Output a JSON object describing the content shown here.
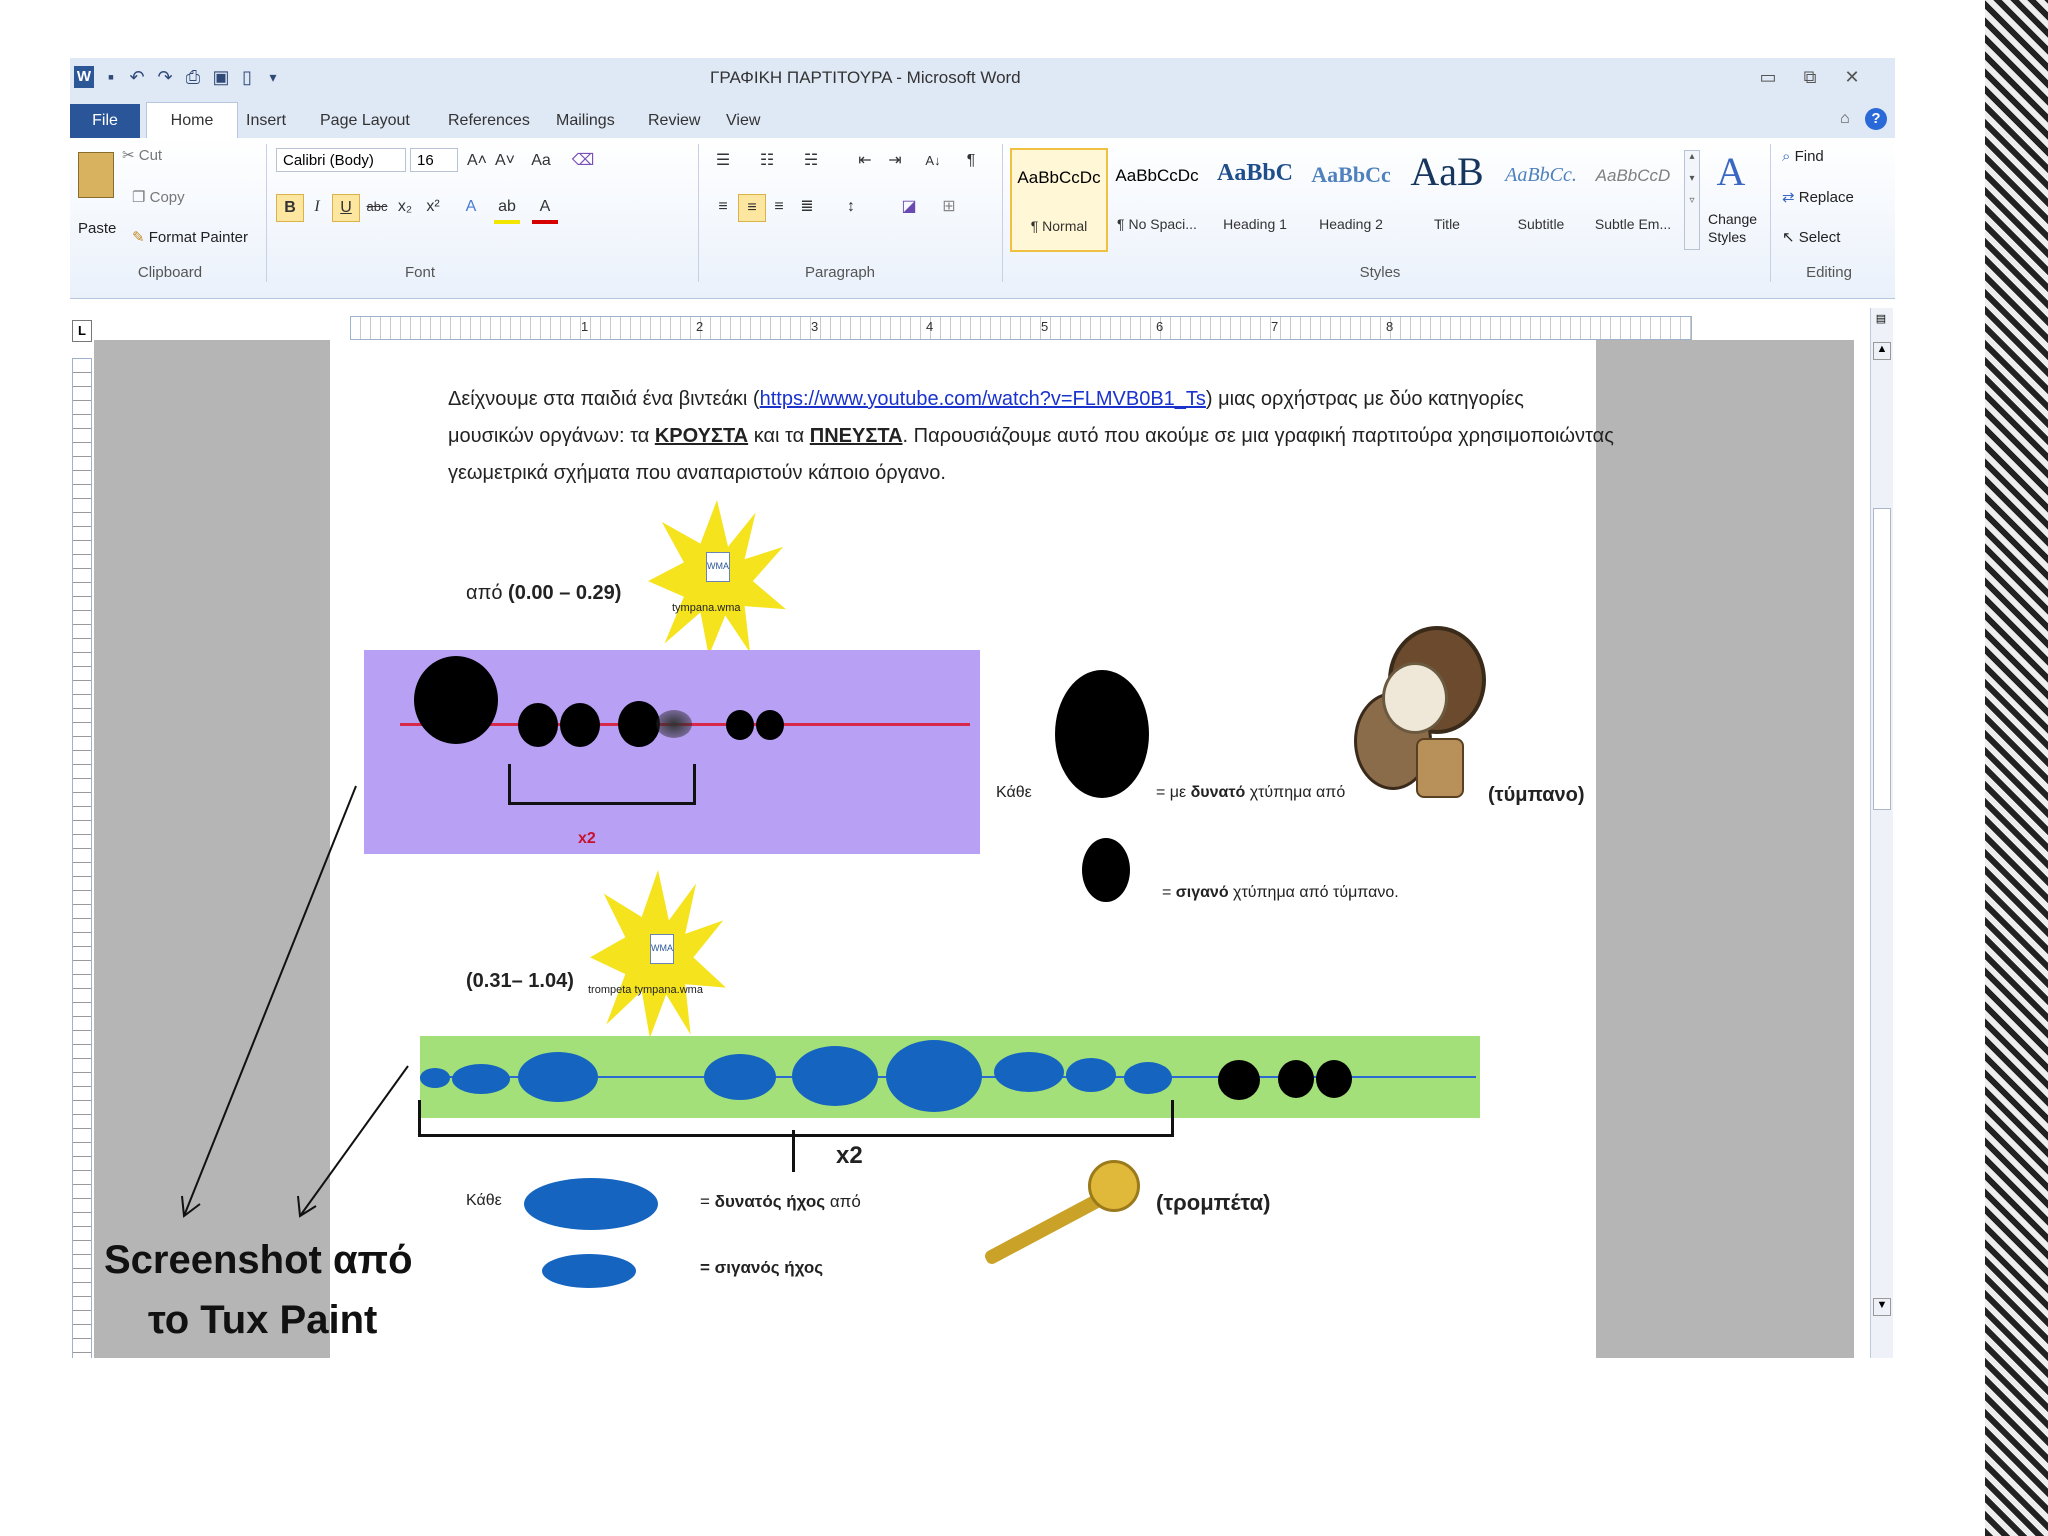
{
  "window": {
    "title": "ΓΡΑΦΙΚΗ ΠΑΡΤΙΤΟΥΡΑ - Microsoft Word",
    "controls": [
      "▭",
      "⧉",
      "✕"
    ]
  },
  "tabs": [
    "File",
    "Home",
    "Insert",
    "Page Layout",
    "References",
    "Mailings",
    "Review",
    "View"
  ],
  "ribbon": {
    "clipboard": {
      "paste": "Paste",
      "cut": "Cut",
      "copy": "Copy",
      "format_painter": "Format Painter",
      "label": "Clipboard"
    },
    "font": {
      "name": "Calibri (Body)",
      "size": "16",
      "label": "Font"
    },
    "paragraph": {
      "label": "Paragraph"
    },
    "styles": {
      "label": "Styles",
      "items": [
        {
          "sample": "AaBbCcDc",
          "name": "¶ Normal"
        },
        {
          "sample": "AaBbCcDc",
          "name": "¶ No Spaci..."
        },
        {
          "sample": "AaBbC",
          "name": "Heading 1"
        },
        {
          "sample": "AaBbCc",
          "name": "Heading 2"
        },
        {
          "sample": "AaB",
          "name": "Title"
        },
        {
          "sample": "AaBbCc.",
          "name": "Subtitle"
        },
        {
          "sample": "AaBbCcD",
          "name": "Subtle Em..."
        }
      ],
      "change_styles": "Change Styles"
    },
    "editing": {
      "find": "Find",
      "replace": "Replace",
      "select": "Select",
      "label": "Editing"
    }
  },
  "ruler": {
    "numbers": [
      "1",
      "2",
      "3",
      "4",
      "5",
      "6",
      "7",
      "8"
    ],
    "corner": "L"
  },
  "document": {
    "para_line1_a": "Δείχνουμε στα παιδιά ένα βιντεάκι (",
    "link": "https://www.youtube.com/watch?v=FLMVB0B1_Ts",
    "para_line1_b": ")  μιας ορχήστρας με δύο κατηγορίες",
    "para_line2_a": "μουσικών οργάνων: τα ",
    "kroysta": "ΚΡΟΥΣΤΑ",
    "para_line2_b": " και τα ",
    "pneysta": "ΠΝΕΥΣΤΑ",
    "para_line2_c": ".  Παρουσιάζουμε αυτό που ακούμε σε μια γραφική παρτιτούρα χρησιμοποιώντας",
    "para_line3": "γεωμετρικά σχήματα που αναπαριστούν κάποιο όργανο.",
    "section1_label_a": "από ",
    "section1_label_b": "(0.00 – 0.29)",
    "media1": "tympana.wma",
    "media_badge": "WMA",
    "x2_a": "x2",
    "kathe1": "Κάθε",
    "loud_drum_a": "= με  ",
    "loud_drum_bold": "δυνατό",
    "loud_drum_b": " χτύπημα από",
    "tympano": "(τύμπανο)",
    "soft_drum_a": "= ",
    "soft_drum_bold": "σιγανό",
    "soft_drum_b": " χτύπημα από τύμπανο.",
    "section2_label": "(0.31– 1.04)",
    "media2": "trompeta tympana.wma",
    "x2_b": "x2",
    "kathe2": "Κάθε",
    "loud_sound_a": "= ",
    "loud_sound_bold": "δυνατός ήχος",
    "loud_sound_b": " από",
    "trompeta": "(τρομπέτα)",
    "soft_sound": "= σιγανός ήχος"
  },
  "caption": {
    "line1": "Screenshot από",
    "line2": "το Tux Paint"
  },
  "colors": {
    "purple_bg": "#b8a1f5",
    "green_bg": "#a3e07a",
    "blue_shape": "#1565c0",
    "ribbon_blue": "#2a5699",
    "star_yellow": "#f5e31e"
  }
}
